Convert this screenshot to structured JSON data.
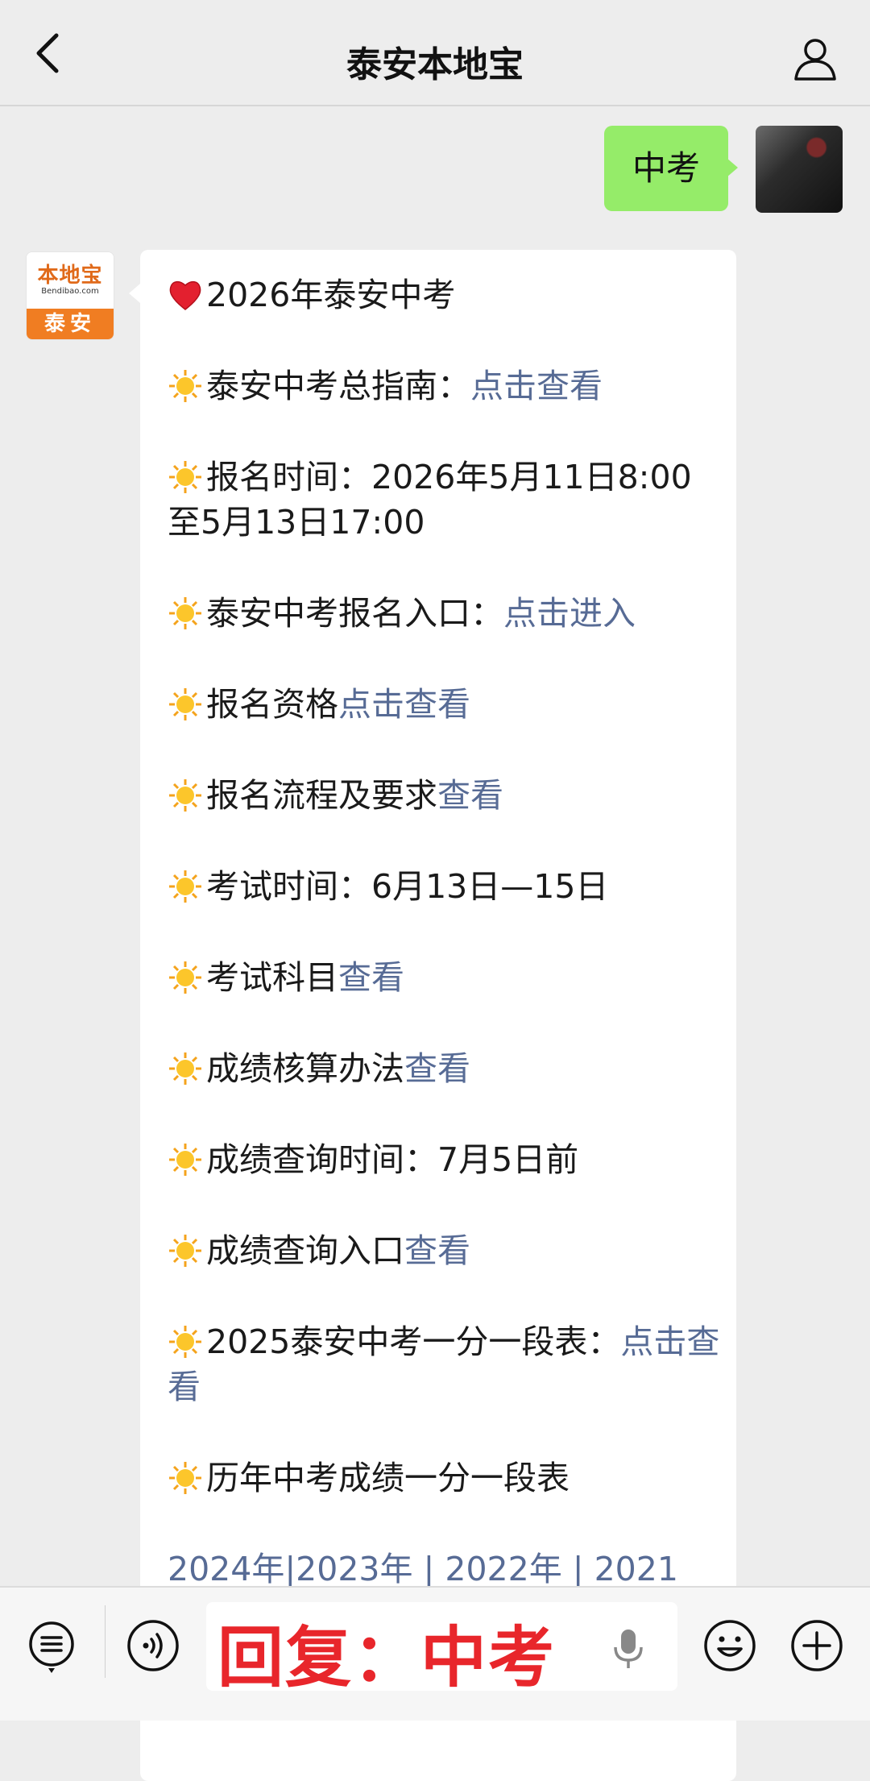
{
  "header": {
    "title": "泰安本地宝"
  },
  "outgoing": {
    "text": "中考"
  },
  "bot": {
    "logo_name": "本地宝",
    "logo_url": "Bendibao.com",
    "logo_city": "泰安"
  },
  "message": {
    "title": "2026年泰安中考",
    "items": [
      {
        "text": "泰安中考总指南：",
        "link": "点击查看"
      },
      {
        "text": "报名时间：2026年5月11日8:00至5月13日17:00",
        "link": ""
      },
      {
        "text": "泰安中考报名入口：",
        "link": "点击进入"
      },
      {
        "text": "报名资格",
        "link": "点击查看"
      },
      {
        "text": "报名流程及要求",
        "link": "查看"
      },
      {
        "text": "考试时间：6月13日—15日",
        "link": ""
      },
      {
        "text": "考试科目",
        "link": "查看"
      },
      {
        "text": "成绩核算办法",
        "link": "查看"
      },
      {
        "text": "成绩查询时间：7月5日前",
        "link": ""
      },
      {
        "text": "成绩查询入口",
        "link": "查看"
      },
      {
        "text": "2025泰安中考一分一段表：",
        "link": "点击查看"
      },
      {
        "text": "历年中考成绩一分一段表",
        "link": ""
      }
    ],
    "years_line": "2024年|2023年 | 2022年 | 2021"
  },
  "toolbar": {
    "overlay": "回复：中考"
  },
  "colors": {
    "link": "#576b95",
    "out_bubble": "#95ec69",
    "overlay": "#e8262b"
  }
}
